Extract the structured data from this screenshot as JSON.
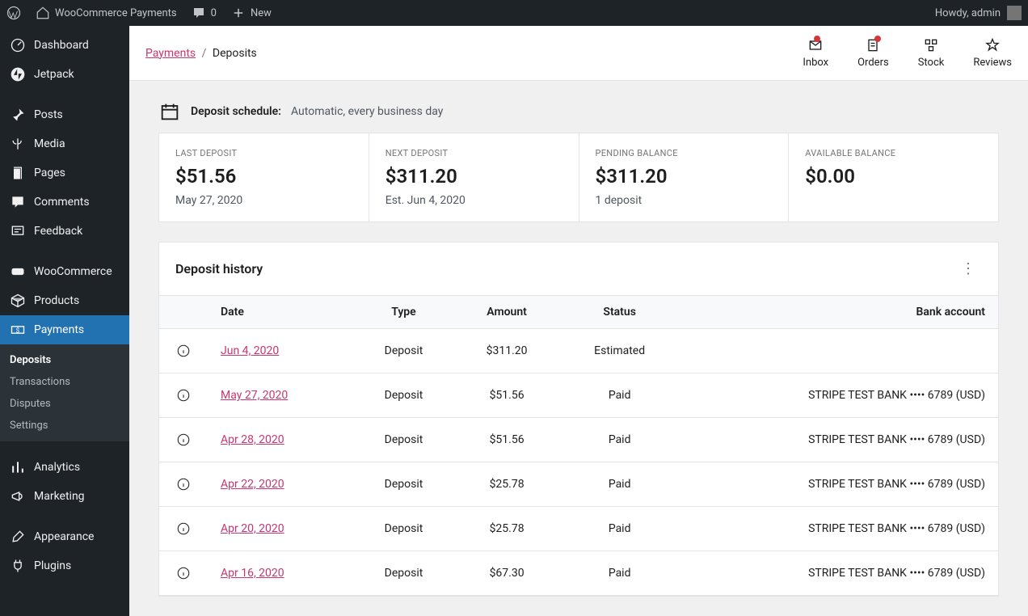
{
  "adminbar": {
    "site_name": "WooCommerce Payments",
    "comments_count": "0",
    "new_label": "New",
    "howdy": "Howdy, admin"
  },
  "sidebar": {
    "items": [
      {
        "icon": "dashboard",
        "label": "Dashboard"
      },
      {
        "icon": "jetpack",
        "label": "Jetpack"
      },
      {
        "icon": "pin",
        "label": "Posts"
      },
      {
        "icon": "media",
        "label": "Media"
      },
      {
        "icon": "page",
        "label": "Pages"
      },
      {
        "icon": "comment",
        "label": "Comments"
      },
      {
        "icon": "feedback",
        "label": "Feedback"
      },
      {
        "icon": "woo",
        "label": "WooCommerce"
      },
      {
        "icon": "box",
        "label": "Products"
      },
      {
        "icon": "cash",
        "label": "Payments"
      },
      {
        "icon": "chart",
        "label": "Analytics"
      },
      {
        "icon": "megaphone",
        "label": "Marketing"
      },
      {
        "icon": "brush",
        "label": "Appearance"
      },
      {
        "icon": "plug",
        "label": "Plugins"
      }
    ],
    "submenu": [
      {
        "label": "Deposits",
        "current": true
      },
      {
        "label": "Transactions",
        "current": false
      },
      {
        "label": "Disputes",
        "current": false
      },
      {
        "label": "Settings",
        "current": false
      }
    ]
  },
  "breadcrumb": {
    "parent": "Payments",
    "current": "Deposits"
  },
  "activity": [
    {
      "icon": "inbox",
      "label": "Inbox",
      "dot": true
    },
    {
      "icon": "orders",
      "label": "Orders",
      "dot": true
    },
    {
      "icon": "stock",
      "label": "Stock",
      "dot": false
    },
    {
      "icon": "reviews",
      "label": "Reviews",
      "dot": false
    }
  ],
  "schedule": {
    "label": "Deposit schedule:",
    "value": "Automatic, every business day"
  },
  "cards": [
    {
      "caption": "LAST DEPOSIT",
      "big": "$51.56",
      "sub": "May 27, 2020"
    },
    {
      "caption": "NEXT DEPOSIT",
      "big": "$311.20",
      "sub": "Est. Jun 4, 2020"
    },
    {
      "caption": "PENDING BALANCE",
      "big": "$311.20",
      "sub": "1 deposit"
    },
    {
      "caption": "AVAILABLE BALANCE",
      "big": "$0.00",
      "sub": ""
    }
  ],
  "history": {
    "title": "Deposit history",
    "columns": [
      "",
      "Date",
      "Type",
      "Amount",
      "Status",
      "Bank account"
    ],
    "rows": [
      {
        "date": "Jun 4, 2020",
        "type": "Deposit",
        "amount": "$311.20",
        "status": "Estimated",
        "bank": ""
      },
      {
        "date": "May 27, 2020",
        "type": "Deposit",
        "amount": "$51.56",
        "status": "Paid",
        "bank": "STRIPE TEST BANK •••• 6789 (USD)"
      },
      {
        "date": "Apr 28, 2020",
        "type": "Deposit",
        "amount": "$51.56",
        "status": "Paid",
        "bank": "STRIPE TEST BANK •••• 6789 (USD)"
      },
      {
        "date": "Apr 22, 2020",
        "type": "Deposit",
        "amount": "$25.78",
        "status": "Paid",
        "bank": "STRIPE TEST BANK •••• 6789 (USD)"
      },
      {
        "date": "Apr 20, 2020",
        "type": "Deposit",
        "amount": "$25.78",
        "status": "Paid",
        "bank": "STRIPE TEST BANK •••• 6789 (USD)"
      },
      {
        "date": "Apr 16, 2020",
        "type": "Deposit",
        "amount": "$67.30",
        "status": "Paid",
        "bank": "STRIPE TEST BANK •••• 6789 (USD)"
      }
    ]
  }
}
